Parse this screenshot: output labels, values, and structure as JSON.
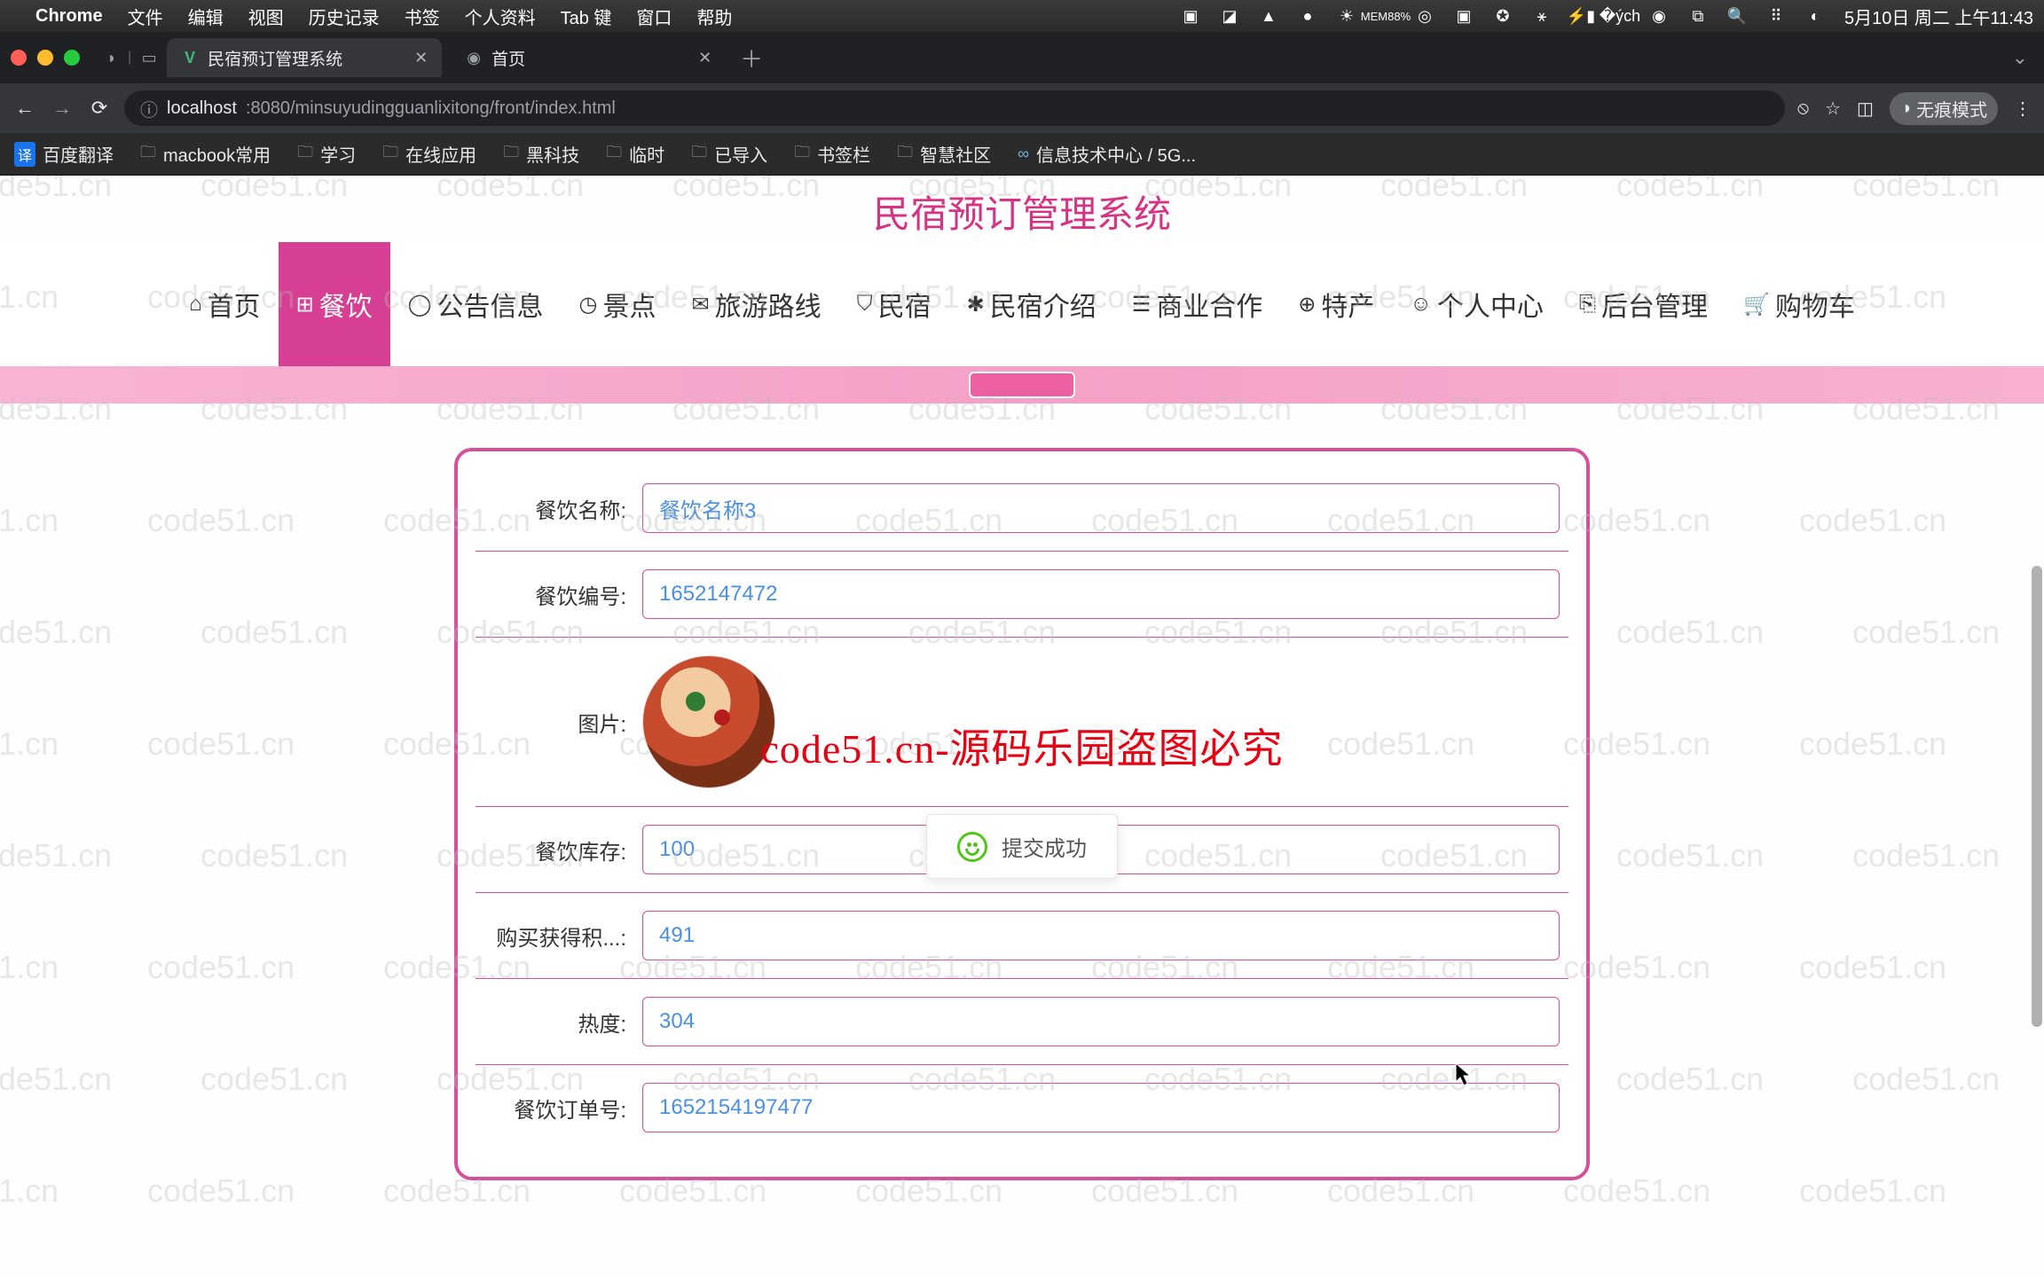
{
  "macos": {
    "app": "Chrome",
    "menus": [
      "文件",
      "编辑",
      "视图",
      "历史记录",
      "书签",
      "个人资料",
      "Tab 键",
      "窗口",
      "帮助"
    ],
    "mem": "88%",
    "clock": "5月10日 周二 上午11:43"
  },
  "chrome": {
    "tabs": [
      {
        "title": "民宿预订管理系统",
        "icon": "V"
      },
      {
        "title": "首页",
        "icon": "◉"
      }
    ],
    "url_host": "localhost",
    "url_port_path": ":8080/minsuyudingguanlixitong/front/index.html",
    "incognito": "无痕模式",
    "bookmarks": [
      {
        "icon": "译",
        "label": "百度翻译"
      },
      {
        "icon": "folder",
        "label": "macbook常用"
      },
      {
        "icon": "folder",
        "label": "学习"
      },
      {
        "icon": "folder",
        "label": "在线应用"
      },
      {
        "icon": "folder",
        "label": "黑科技"
      },
      {
        "icon": "folder",
        "label": "临时"
      },
      {
        "icon": "folder",
        "label": "已导入"
      },
      {
        "icon": "folder",
        "label": "书签栏"
      },
      {
        "icon": "folder",
        "label": "智慧社区"
      },
      {
        "icon": "link",
        "label": "信息技术中心 / 5G..."
      }
    ]
  },
  "page": {
    "title": "民宿预订管理系统",
    "nav": [
      {
        "icon": "⌂",
        "label": "首页"
      },
      {
        "icon": "⊞",
        "label": "餐饮",
        "active": true
      },
      {
        "icon": "◯",
        "label": "公告信息"
      },
      {
        "icon": "◷",
        "label": "景点"
      },
      {
        "icon": "✉",
        "label": "旅游路线"
      },
      {
        "icon": "⛉",
        "label": "民宿"
      },
      {
        "icon": "✱",
        "label": "民宿介绍"
      },
      {
        "icon": "☰",
        "label": "商业合作"
      },
      {
        "icon": "⊕",
        "label": "特产"
      },
      {
        "icon": "☺",
        "label": "个人中心"
      },
      {
        "icon": "⎘",
        "label": "后台管理"
      },
      {
        "icon": "🛒",
        "label": "购物车"
      }
    ],
    "form": {
      "name_label": "餐饮名称:",
      "name_value": "餐饮名称3",
      "code_label": "餐饮编号:",
      "code_value": "1652147472",
      "image_label": "图片:",
      "stock_label": "餐饮库存:",
      "stock_value": "100",
      "points_label": "购买获得积...:",
      "points_value": "491",
      "heat_label": "热度:",
      "heat_value": "304",
      "order_label": "餐饮订单号:",
      "order_value": "1652154197477"
    },
    "toast": "提交成功",
    "red_overlay": "code51.cn-源码乐园盗图必究",
    "watermark": "code51.cn"
  }
}
